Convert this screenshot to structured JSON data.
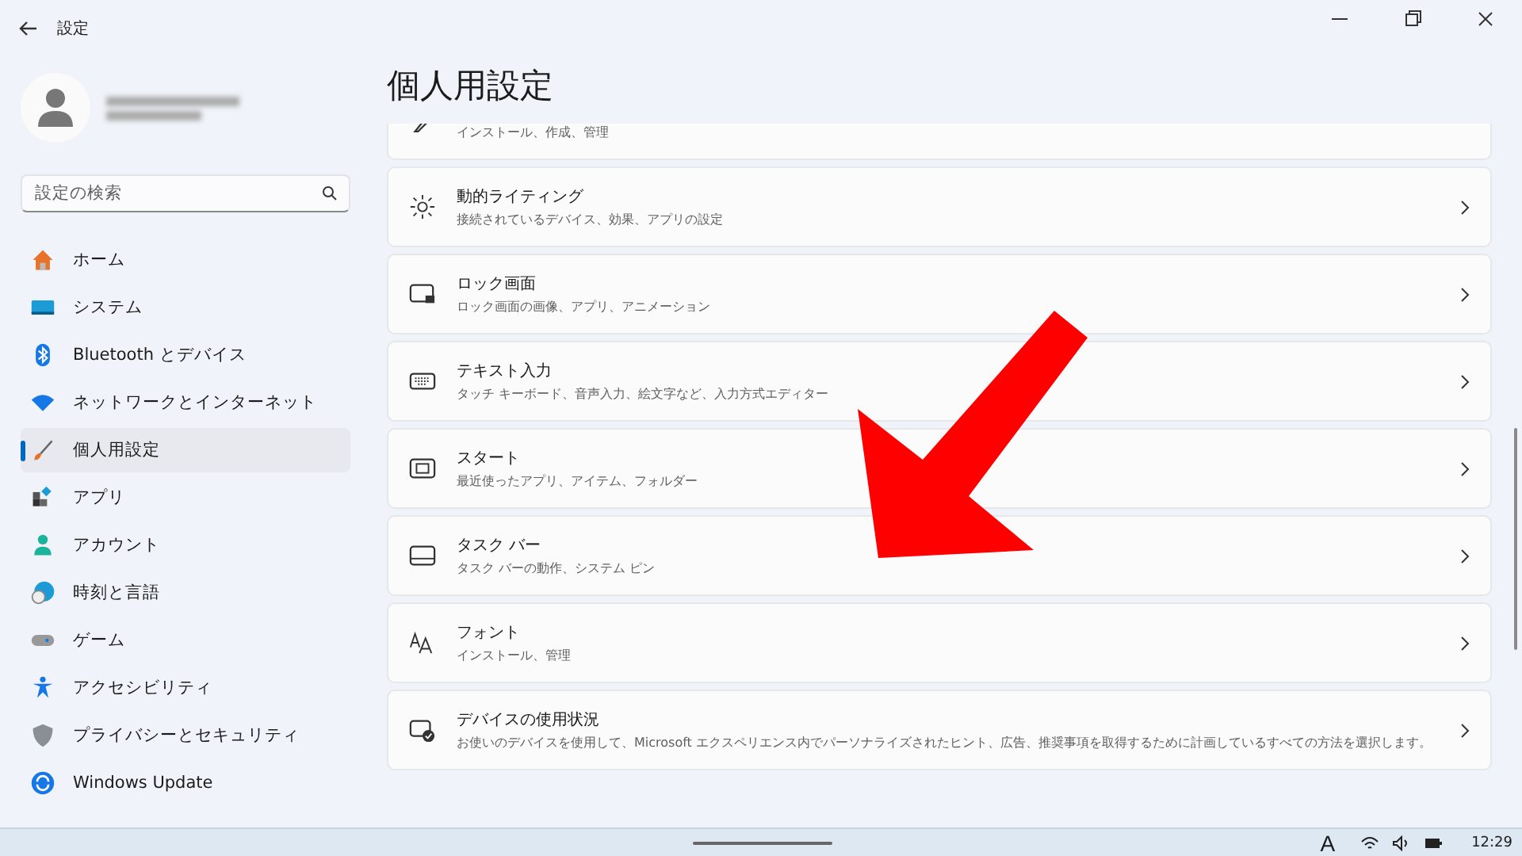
{
  "window": {
    "title": "設定"
  },
  "search": {
    "placeholder": "設定の検索"
  },
  "nav": [
    {
      "label": "ホーム",
      "selected": false
    },
    {
      "label": "システム",
      "selected": false
    },
    {
      "label": "Bluetooth とデバイス",
      "selected": false
    },
    {
      "label": "ネットワークとインターネット",
      "selected": false
    },
    {
      "label": "個人用設定",
      "selected": true
    },
    {
      "label": "アプリ",
      "selected": false
    },
    {
      "label": "アカウント",
      "selected": false
    },
    {
      "label": "時刻と言語",
      "selected": false
    },
    {
      "label": "ゲーム",
      "selected": false
    },
    {
      "label": "アクセシビリティ",
      "selected": false
    },
    {
      "label": "プライバシーとセキュリティ",
      "selected": false
    },
    {
      "label": "Windows Update",
      "selected": false
    }
  ],
  "page_title": "個人用設定",
  "cards": [
    {
      "kind": "partial",
      "subtitle": "インストール、作成、管理"
    },
    {
      "kind": "full",
      "title": "動的ライティング",
      "subtitle": "接続されているデバイス、効果、アプリの設定"
    },
    {
      "kind": "full",
      "title": "ロック画面",
      "subtitle": "ロック画面の画像、アプリ、アニメーション"
    },
    {
      "kind": "full",
      "title": "テキスト入力",
      "subtitle": "タッチ キーボード、音声入力、絵文字など、入力方式エディター"
    },
    {
      "kind": "full",
      "title": "スタート",
      "subtitle": "最近使ったアプリ、アイテム、フォルダー"
    },
    {
      "kind": "full",
      "title": "タスク バー",
      "subtitle": "タスク バーの動作、システム ピン"
    },
    {
      "kind": "full",
      "title": "フォント",
      "subtitle": "インストール、管理"
    },
    {
      "kind": "full",
      "title": "デバイスの使用状況",
      "subtitle": "お使いのデバイスを使用して、Microsoft エクスペリエンス内でパーソナライズされたヒント、広告、推奨事項を取得するために計画しているすべての方法を選択します。"
    }
  ],
  "taskbar": {
    "ime": "A",
    "time": "12:29"
  }
}
